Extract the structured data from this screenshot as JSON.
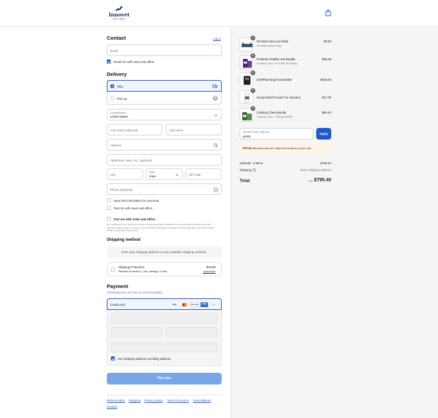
{
  "brand": {
    "name": "Innovet",
    "tagline": "EST. 2005",
    "primary_color": "#1f5ac9",
    "logo_color": "#1d3557"
  },
  "contact": {
    "title": "Contact",
    "login_link": "Log in",
    "email_placeholder": "Email",
    "news_offers_label": "Email me with news and offers",
    "news_offers_checked": true
  },
  "delivery": {
    "title": "Delivery",
    "options": [
      {
        "label": "Ship",
        "selected": true,
        "icon": "truck-icon"
      },
      {
        "label": "Pick up",
        "selected": false,
        "icon": "store-icon"
      }
    ],
    "country_label": "Country/Region",
    "country_value": "United States",
    "first_name_placeholder": "First name (optional)",
    "last_name_placeholder": "Last name",
    "address_placeholder": "Address",
    "apartment_placeholder": "Apartment, suite, etc. (optional)",
    "city_placeholder": "City",
    "state_label": "State",
    "state_value": "Iowa",
    "zip_placeholder": "ZIP code",
    "phone_placeholder": "Phone (optional)",
    "save_info_label": "Save this information for next time",
    "text_offers_label": "Text me with news and offers",
    "text_offers_bold_label": "Text me with news and offers",
    "sms_disclaimer_1": "By checking this box I consent to receive recurring automated marketing by text message through an automatic",
    "sms_disclaimer_2": "telephone dialing system. Consent is not a condition to purchase. Message and Data rate apply. Opt Out by texting",
    "sms_disclaimer_3": "STOP. View Privacy Policy & ToS"
  },
  "shipping_method": {
    "title": "Shipping method",
    "empty_message": "Enter your shipping address to view available shipping methods.",
    "protection_title": "Shipping Protection",
    "protection_desc": "Effortless Protection | Loss, damage, or theft",
    "protection_price": "$15.99",
    "protection_link": "Learn More"
  },
  "payment": {
    "title": "Payment",
    "subtitle": "All transactions are secure and encrypted.",
    "method_label": "Credit card",
    "card_brands": [
      "VISA",
      "MC",
      "DISCOVER",
      "AMEX",
      "+4"
    ],
    "billing_same_label": "Use shipping address as billing address",
    "billing_same_checked": true,
    "pay_button": "Pay now"
  },
  "footer_links": [
    "Refund policy",
    "Shipping",
    "Privacy policy",
    "Terms of service",
    "Cancellations",
    "Contact"
  ],
  "order_summary": {
    "items": [
      {
        "name": "K9 Dock Sea Lion Rails",
        "variant": "Unmasked (parts only)",
        "price": "$3.50",
        "qty": "1"
      },
      {
        "name": "Probiotic Healthy Gut Bundle",
        "variant": "Probiotic Chew + PurCBD Oil 250mg",
        "price": "$65.48",
        "qty": "1"
      },
      {
        "name": "ChefPaw Dog Food Maker",
        "variant": "",
        "price": "$649.00",
        "qty": "1"
      },
      {
        "name": "Hemp Relief Cream For Humans",
        "variant": "",
        "price": "$17.00",
        "qty": "1"
      },
      {
        "name": "Calming Chew Bundle",
        "variant": "Calming Chew + 125mg PurCBD",
        "price": "$60.42",
        "qty": "1"
      }
    ],
    "discount_label": "Discount code or gift card",
    "discount_value": "pet25",
    "apply_button": "Apply",
    "warning_code": "PET25",
    "warning_text": " discount code isn't valid for the items in your cart",
    "subtotal_label": "Subtotal · 5 items",
    "subtotal_value": "$795.40",
    "shipping_label": "Shipping",
    "shipping_value": "Enter shipping address",
    "total_label": "Total",
    "total_currency": "USD",
    "total_value": "$795.40"
  }
}
